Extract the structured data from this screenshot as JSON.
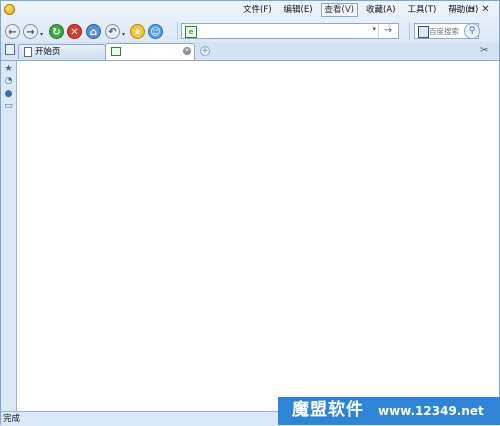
{
  "menu": {
    "items": [
      {
        "label": "文件(F)"
      },
      {
        "label": "编辑(E)"
      },
      {
        "label": "查看(V)"
      },
      {
        "label": "收藏(A)"
      },
      {
        "label": "工具(T)"
      },
      {
        "label": "帮助(H)"
      }
    ]
  },
  "window_controls": {
    "minimize_icon": "minimize-icon",
    "maximize_icon": "maximize-icon",
    "close_icon": "close-icon"
  },
  "colors": {
    "chrome": "#dbe8f7",
    "border": "#8fa9c9",
    "accent": "#2b6db8",
    "watermark_bg": "#2f84d6"
  },
  "address_bar": {
    "value": ""
  },
  "search": {
    "placeholder": "百度搜索"
  },
  "tabs": [
    {
      "label": "开始页"
    },
    {
      "label": ""
    }
  ],
  "status": {
    "text": "完成"
  },
  "watermark": {
    "brand": "魔盟软件",
    "url": "www.12349.net"
  }
}
